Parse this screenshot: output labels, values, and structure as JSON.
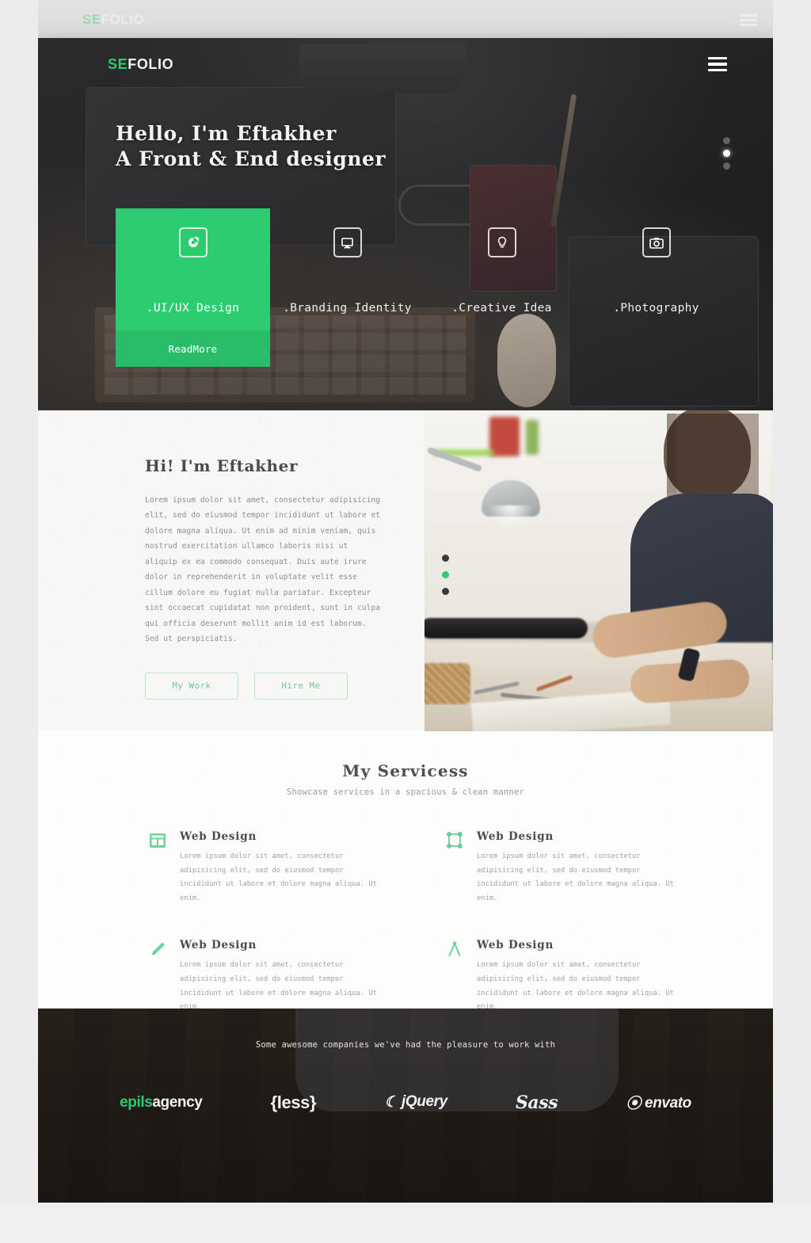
{
  "ghost": {
    "logo_prefix": "SE",
    "logo_suffix": "FOLIO",
    "menu_icon": "hamburger-menu-icon"
  },
  "hero": {
    "logo_prefix": "SE",
    "logo_suffix": "FOLIO",
    "menu_icon": "hamburger-menu-icon",
    "headline_line1": "Hello, I'm Eftakher",
    "headline_line2": "A Front & End designer",
    "slider_dots": 3,
    "active_dot": 2,
    "cards": [
      {
        "title": ".UI/UX Design",
        "icon": "ui-ux-icon",
        "active": true,
        "cta": "ReadMore"
      },
      {
        "title": ".Branding Identity",
        "icon": "monitor-icon",
        "active": false,
        "cta": ""
      },
      {
        "title": ".Creative Idea",
        "icon": "lightbulb-icon",
        "active": false,
        "cta": ""
      },
      {
        "title": ".Photography",
        "icon": "camera-icon",
        "active": false,
        "cta": ""
      }
    ]
  },
  "about": {
    "title": "Hi! I'm Eftakher",
    "body": "Lorem ipsum dolor sit amet, consectetur adipisicing elit, sed do eiusmod tempor incididunt ut labore et dolore magna aliqua. Ut enim ad minim veniam, quis nostrud exercitation ullamco laboris nisi ut aliquip ex ea commodo consequat. Duis aute irure dolor in reprehenderit in voluptate velit esse cillum dolore eu fugiat nulla pariatur. Excepteur sint occaecat cupidatat non proident, sunt in culpa qui officia deserunt mollit anim id est laborum. Sed ut perspiciatis.",
    "button_primary": "My Work",
    "button_secondary": "Hire Me",
    "image_dots": 3,
    "image_active_dot": 2
  },
  "services": {
    "title": "My Servicess",
    "subtitle": "Showcase services in a spacious & clean manner",
    "items": [
      {
        "icon": "layout-grid-icon",
        "heading": "Web Design",
        "text": "Lorem ipsum dolor sit amet, consectetur adipisicing elit, sed do eiusmod tempor incididunt ut labore et dolore magna aliqua. Ut enim."
      },
      {
        "icon": "transform-square-icon",
        "heading": "Web Design",
        "text": "Lorem ipsum dolor sit amet, consectetur adipisicing elit, sed do eiusmod tempor incididunt ut labore et dolore magna aliqua. Ut enim."
      },
      {
        "icon": "pen-brush-icon",
        "heading": "Web Design",
        "text": "Lorem ipsum dolor sit amet, consectetur adipisicing elit, sed do eiusmod tempor incididunt ut labore et dolore magna aliqua. Ut enim."
      },
      {
        "icon": "compass-icon",
        "heading": "Web Design",
        "text": "Lorem ipsum dolor sit amet, consectetur adipisicing elit, sed do eiusmod tempor incididunt ut labore et dolore magna aliqua. Ut enim."
      }
    ]
  },
  "clients": {
    "note": "Some awesome companies we've had the pleasure to work with",
    "logos": [
      {
        "name": "epils-agency-logo",
        "accent": "epils",
        "rest": "agency"
      },
      {
        "name": "less-logo",
        "text": "{less}"
      },
      {
        "name": "jquery-logo",
        "text": "jQuery"
      },
      {
        "name": "sass-logo",
        "text": "Sass"
      },
      {
        "name": "envato-logo",
        "text": "envato"
      }
    ]
  },
  "colors": {
    "accent_green": "#2ecc71",
    "hero_dark": "#232325",
    "about_bg": "#f7f7f5",
    "services_bg": "#fdfdfc"
  }
}
